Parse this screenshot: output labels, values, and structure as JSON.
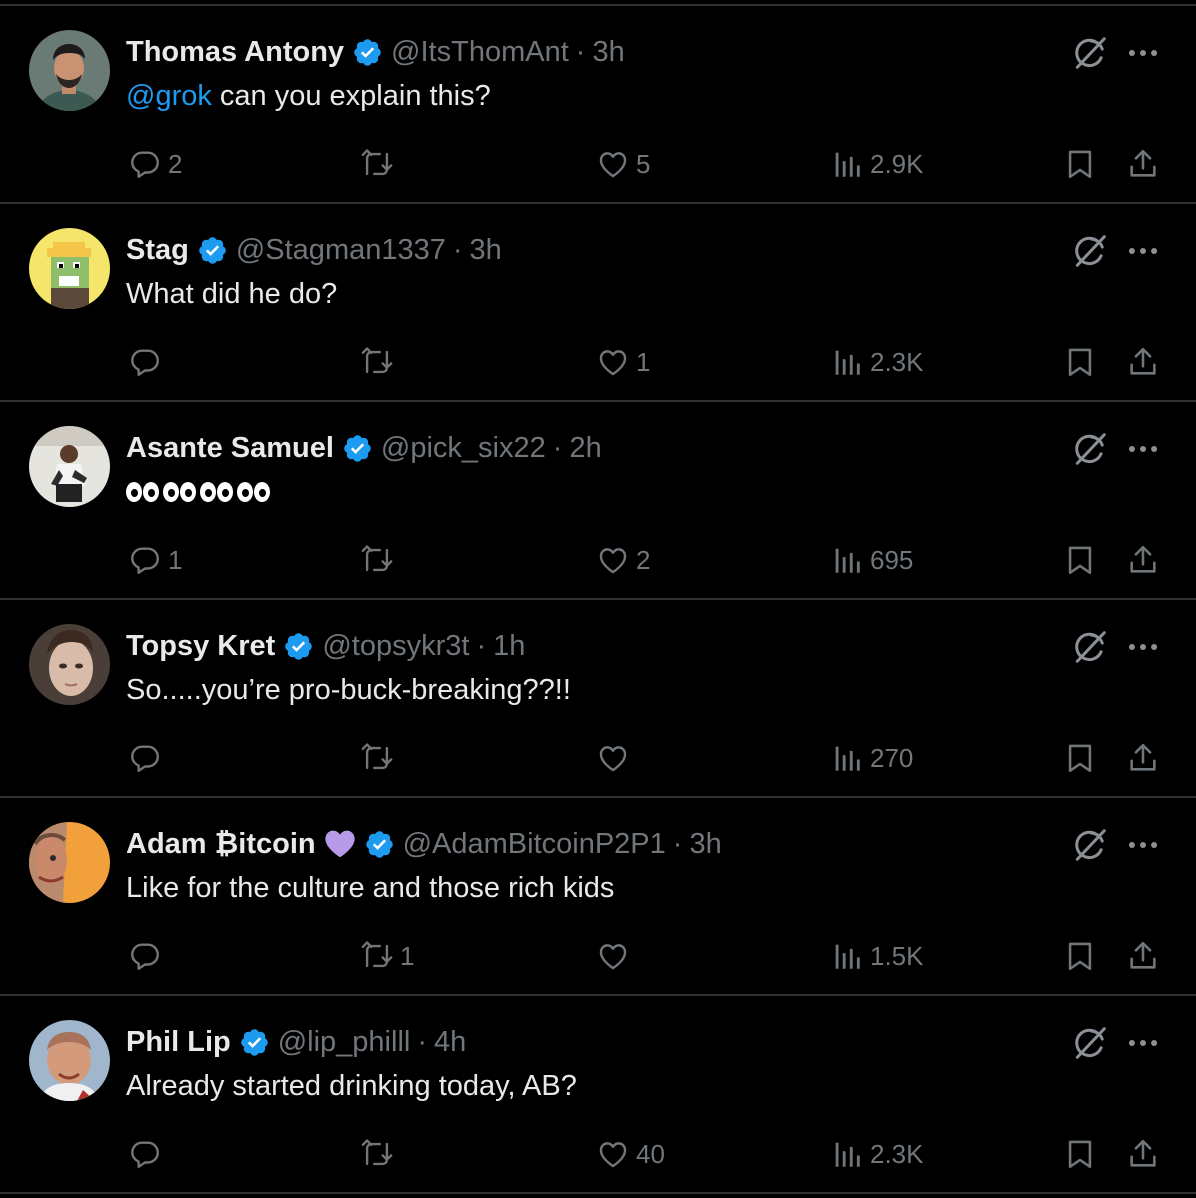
{
  "colors": {
    "background": "#000000",
    "text": "#e7e9ea",
    "muted": "#71767b",
    "accent": "#1d9bf0",
    "divider": "#2f3336",
    "heart_emoji": "#b89be8"
  },
  "icons": {
    "reply": "reply-icon",
    "retweet": "retweet-icon",
    "like": "like-icon",
    "views": "views-icon",
    "bookmark": "bookmark-icon",
    "share": "share-icon",
    "grok": "grok-icon",
    "more": "more-icon",
    "verified": "verified-badge-icon"
  },
  "tweets": [
    {
      "name": "Thomas Antony",
      "handle": "@ItsThomAnt",
      "time": "3h",
      "mention": "@grok",
      "text": " can you explain this?",
      "replies": "2",
      "retweets": "",
      "likes": "5",
      "views": "2.9K"
    },
    {
      "name": "Stag",
      "handle": "@Stagman1337",
      "time": "3h",
      "text": "What did he do?",
      "replies": "",
      "retweets": "",
      "likes": "1",
      "views": "2.3K"
    },
    {
      "name": "Asante Samuel",
      "handle": "@pick_six22",
      "time": "2h",
      "text_emoji": "eyes x4",
      "replies": "1",
      "retweets": "",
      "likes": "2",
      "views": "695"
    },
    {
      "name": "Topsy Kret",
      "handle": "@topsykr3t",
      "time": "1h",
      "text": "So.....you’re pro-buck-breaking??!!",
      "replies": "",
      "retweets": "",
      "likes": "",
      "views": "270"
    },
    {
      "name": "Adam ₿itcoin",
      "name_emoji": "purple-heart",
      "handle": "@AdamBitcoinP2P1",
      "time": "3h",
      "text": "Like for the culture and those rich kids",
      "replies": "",
      "retweets": "1",
      "likes": "",
      "views": "1.5K"
    },
    {
      "name": "Phil Lip",
      "handle": "@lip_philll",
      "time": "4h",
      "text": "Already started drinking today, AB?",
      "replies": "",
      "retweets": "",
      "likes": "40",
      "views": "2.3K"
    }
  ]
}
